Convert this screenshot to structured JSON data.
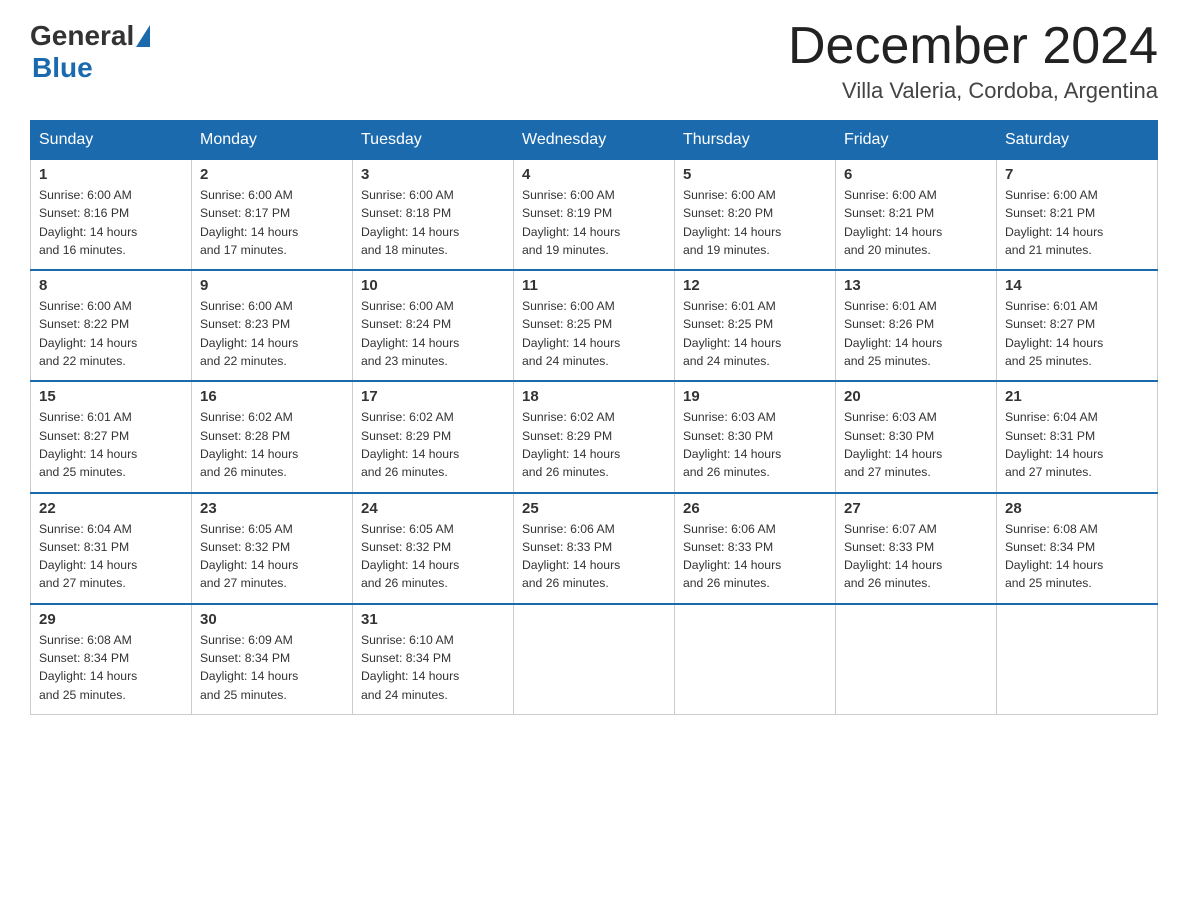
{
  "header": {
    "logo_text1": "General",
    "logo_text2": "Blue",
    "month_title": "December 2024",
    "subtitle": "Villa Valeria, Cordoba, Argentina"
  },
  "days_of_week": [
    "Sunday",
    "Monday",
    "Tuesday",
    "Wednesday",
    "Thursday",
    "Friday",
    "Saturday"
  ],
  "weeks": [
    [
      {
        "day": "1",
        "sunrise": "6:00 AM",
        "sunset": "8:16 PM",
        "daylight": "14 hours and 16 minutes."
      },
      {
        "day": "2",
        "sunrise": "6:00 AM",
        "sunset": "8:17 PM",
        "daylight": "14 hours and 17 minutes."
      },
      {
        "day": "3",
        "sunrise": "6:00 AM",
        "sunset": "8:18 PM",
        "daylight": "14 hours and 18 minutes."
      },
      {
        "day": "4",
        "sunrise": "6:00 AM",
        "sunset": "8:19 PM",
        "daylight": "14 hours and 19 minutes."
      },
      {
        "day": "5",
        "sunrise": "6:00 AM",
        "sunset": "8:20 PM",
        "daylight": "14 hours and 19 minutes."
      },
      {
        "day": "6",
        "sunrise": "6:00 AM",
        "sunset": "8:21 PM",
        "daylight": "14 hours and 20 minutes."
      },
      {
        "day": "7",
        "sunrise": "6:00 AM",
        "sunset": "8:21 PM",
        "daylight": "14 hours and 21 minutes."
      }
    ],
    [
      {
        "day": "8",
        "sunrise": "6:00 AM",
        "sunset": "8:22 PM",
        "daylight": "14 hours and 22 minutes."
      },
      {
        "day": "9",
        "sunrise": "6:00 AM",
        "sunset": "8:23 PM",
        "daylight": "14 hours and 22 minutes."
      },
      {
        "day": "10",
        "sunrise": "6:00 AM",
        "sunset": "8:24 PM",
        "daylight": "14 hours and 23 minutes."
      },
      {
        "day": "11",
        "sunrise": "6:00 AM",
        "sunset": "8:25 PM",
        "daylight": "14 hours and 24 minutes."
      },
      {
        "day": "12",
        "sunrise": "6:01 AM",
        "sunset": "8:25 PM",
        "daylight": "14 hours and 24 minutes."
      },
      {
        "day": "13",
        "sunrise": "6:01 AM",
        "sunset": "8:26 PM",
        "daylight": "14 hours and 25 minutes."
      },
      {
        "day": "14",
        "sunrise": "6:01 AM",
        "sunset": "8:27 PM",
        "daylight": "14 hours and 25 minutes."
      }
    ],
    [
      {
        "day": "15",
        "sunrise": "6:01 AM",
        "sunset": "8:27 PM",
        "daylight": "14 hours and 25 minutes."
      },
      {
        "day": "16",
        "sunrise": "6:02 AM",
        "sunset": "8:28 PM",
        "daylight": "14 hours and 26 minutes."
      },
      {
        "day": "17",
        "sunrise": "6:02 AM",
        "sunset": "8:29 PM",
        "daylight": "14 hours and 26 minutes."
      },
      {
        "day": "18",
        "sunrise": "6:02 AM",
        "sunset": "8:29 PM",
        "daylight": "14 hours and 26 minutes."
      },
      {
        "day": "19",
        "sunrise": "6:03 AM",
        "sunset": "8:30 PM",
        "daylight": "14 hours and 26 minutes."
      },
      {
        "day": "20",
        "sunrise": "6:03 AM",
        "sunset": "8:30 PM",
        "daylight": "14 hours and 27 minutes."
      },
      {
        "day": "21",
        "sunrise": "6:04 AM",
        "sunset": "8:31 PM",
        "daylight": "14 hours and 27 minutes."
      }
    ],
    [
      {
        "day": "22",
        "sunrise": "6:04 AM",
        "sunset": "8:31 PM",
        "daylight": "14 hours and 27 minutes."
      },
      {
        "day": "23",
        "sunrise": "6:05 AM",
        "sunset": "8:32 PM",
        "daylight": "14 hours and 27 minutes."
      },
      {
        "day": "24",
        "sunrise": "6:05 AM",
        "sunset": "8:32 PM",
        "daylight": "14 hours and 26 minutes."
      },
      {
        "day": "25",
        "sunrise": "6:06 AM",
        "sunset": "8:33 PM",
        "daylight": "14 hours and 26 minutes."
      },
      {
        "day": "26",
        "sunrise": "6:06 AM",
        "sunset": "8:33 PM",
        "daylight": "14 hours and 26 minutes."
      },
      {
        "day": "27",
        "sunrise": "6:07 AM",
        "sunset": "8:33 PM",
        "daylight": "14 hours and 26 minutes."
      },
      {
        "day": "28",
        "sunrise": "6:08 AM",
        "sunset": "8:34 PM",
        "daylight": "14 hours and 25 minutes."
      }
    ],
    [
      {
        "day": "29",
        "sunrise": "6:08 AM",
        "sunset": "8:34 PM",
        "daylight": "14 hours and 25 minutes."
      },
      {
        "day": "30",
        "sunrise": "6:09 AM",
        "sunset": "8:34 PM",
        "daylight": "14 hours and 25 minutes."
      },
      {
        "day": "31",
        "sunrise": "6:10 AM",
        "sunset": "8:34 PM",
        "daylight": "14 hours and 24 minutes."
      },
      null,
      null,
      null,
      null
    ]
  ],
  "label_sunrise": "Sunrise:",
  "label_sunset": "Sunset:",
  "label_daylight": "Daylight:"
}
